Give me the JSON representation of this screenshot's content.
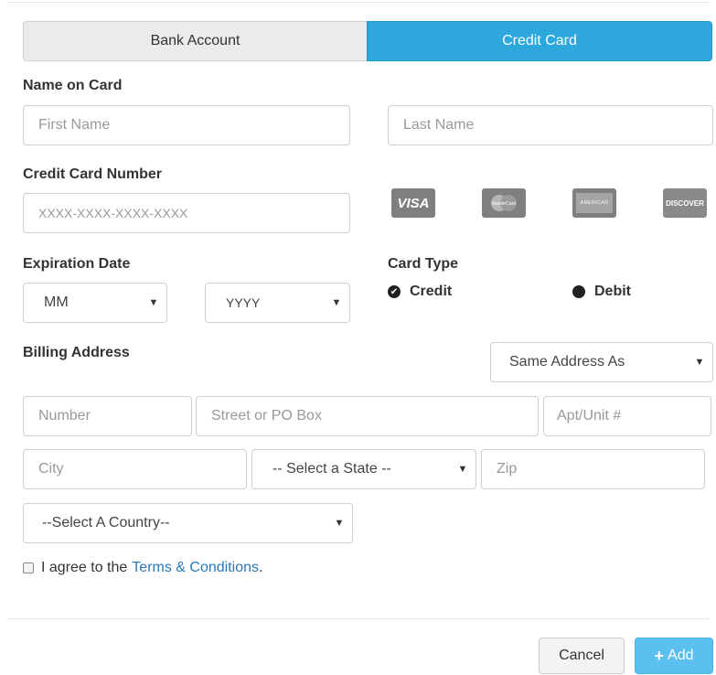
{
  "tabs": {
    "bank_account": "Bank Account",
    "credit_card": "Credit Card"
  },
  "name_on_card": {
    "label": "Name on Card",
    "first_placeholder": "First Name",
    "last_placeholder": "Last Name"
  },
  "card_number": {
    "label": "Credit Card Number",
    "placeholder": "XXXX-XXXX-XXXX-XXXX"
  },
  "card_logos": {
    "visa": "VISA",
    "mastercard": "MasterCard",
    "amex": "AMERICAN EXPRESS",
    "discover": "DISCOVER"
  },
  "expiration": {
    "label": "Expiration Date",
    "month_value": "MM",
    "year_value": "YYYY"
  },
  "card_type": {
    "label": "Card Type",
    "options": [
      "Credit",
      "Debit"
    ],
    "selected": "Credit"
  },
  "billing": {
    "label": "Billing Address",
    "same_address_value": "Same Address As",
    "number_placeholder": "Number",
    "street_placeholder": "Street or PO Box",
    "apt_placeholder": "Apt/Unit #",
    "city_placeholder": "City",
    "state_value": "-- Select a State --",
    "zip_placeholder": "Zip",
    "country_value": "--Select A Country--"
  },
  "terms": {
    "prefix": "I agree to the",
    "link": "Terms & Conditions",
    "suffix": "."
  },
  "buttons": {
    "cancel": "Cancel",
    "add": "Add"
  },
  "colors": {
    "accent": "#2ea8dc",
    "add_button": "#5bc0f0",
    "link": "#2a78b8"
  }
}
